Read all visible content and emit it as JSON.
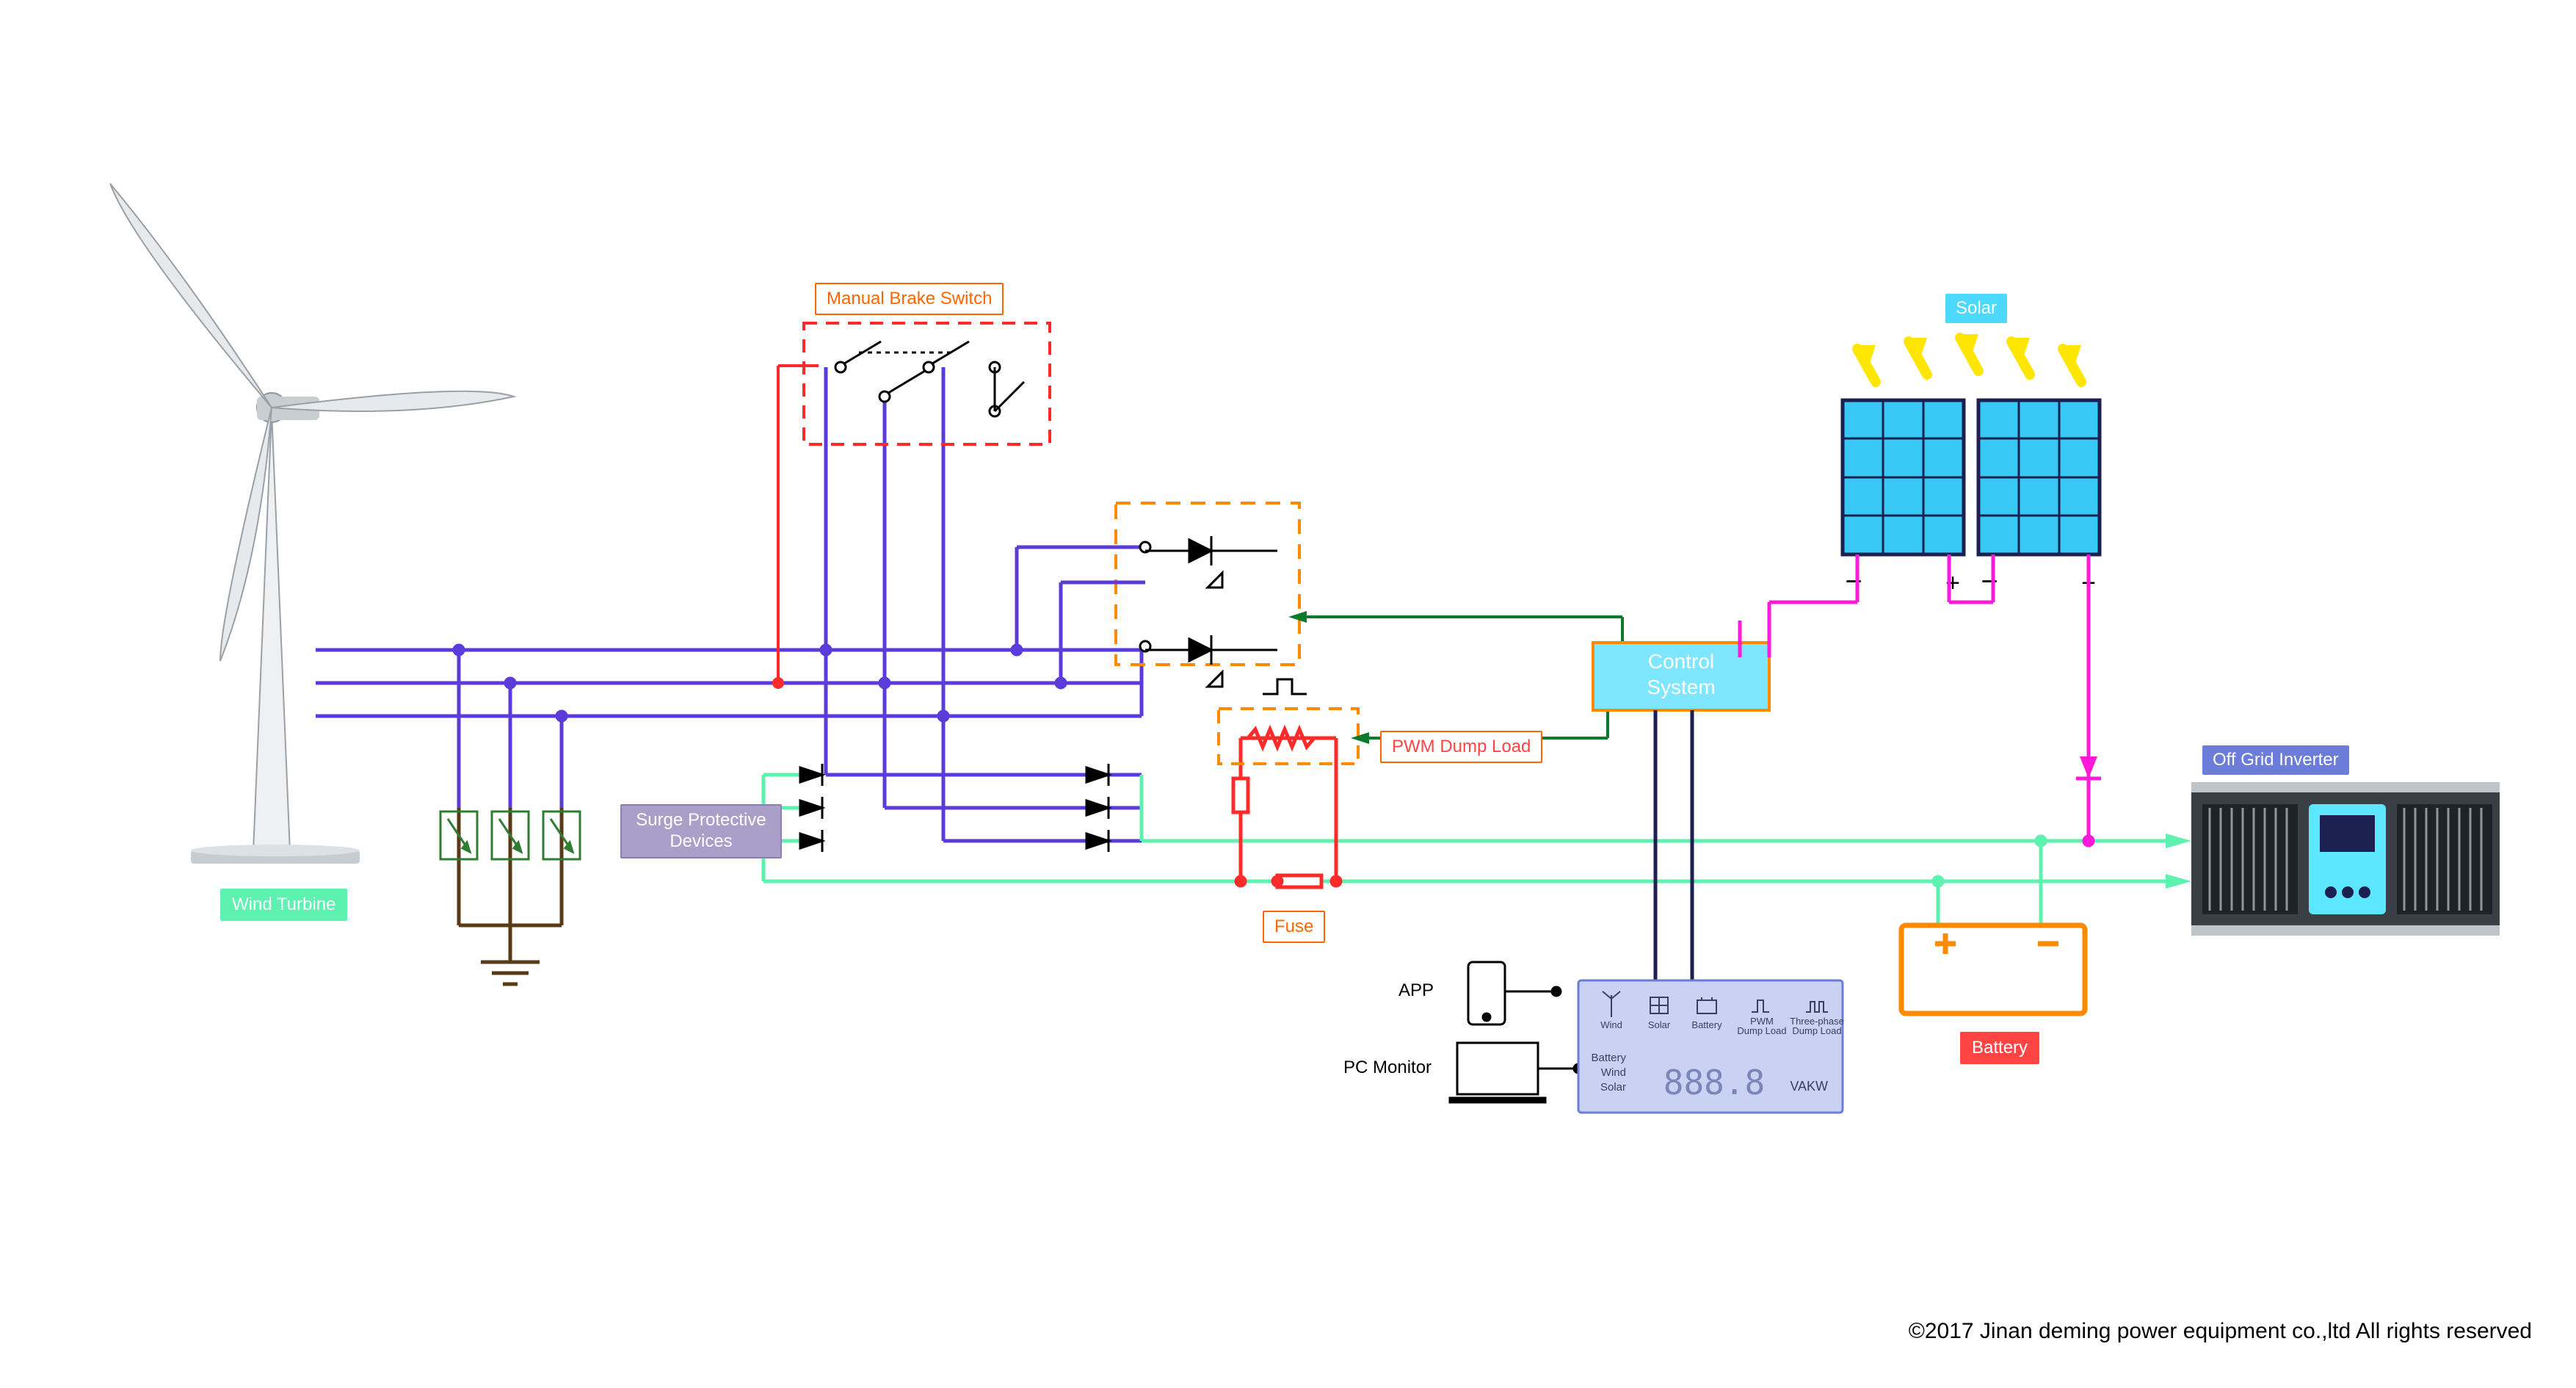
{
  "labels": {
    "wind_turbine": "Wind Turbine",
    "surge_protective": "Surge Protective Devices",
    "manual_brake": "Manual Brake Switch",
    "pwm_dump": "PWM Dump Load",
    "fuse": "Fuse",
    "app": "APP",
    "pc_monitor": "PC Monitor",
    "control_system": "Control System",
    "solar": "Solar",
    "battery": "Battery",
    "off_grid": "Off Grid Inverter"
  },
  "monitor_panel": {
    "icons": [
      "Wind",
      "Solar",
      "Battery",
      "PWM Dump Load",
      "Three-phase Dump Load"
    ],
    "side_labels": [
      "Battery",
      "Wind",
      "Solar"
    ],
    "display_value": "888.8",
    "display_units": "VAKW"
  },
  "copyright": "©2017 Jinan deming power equipment co.,ltd All rights reserved"
}
